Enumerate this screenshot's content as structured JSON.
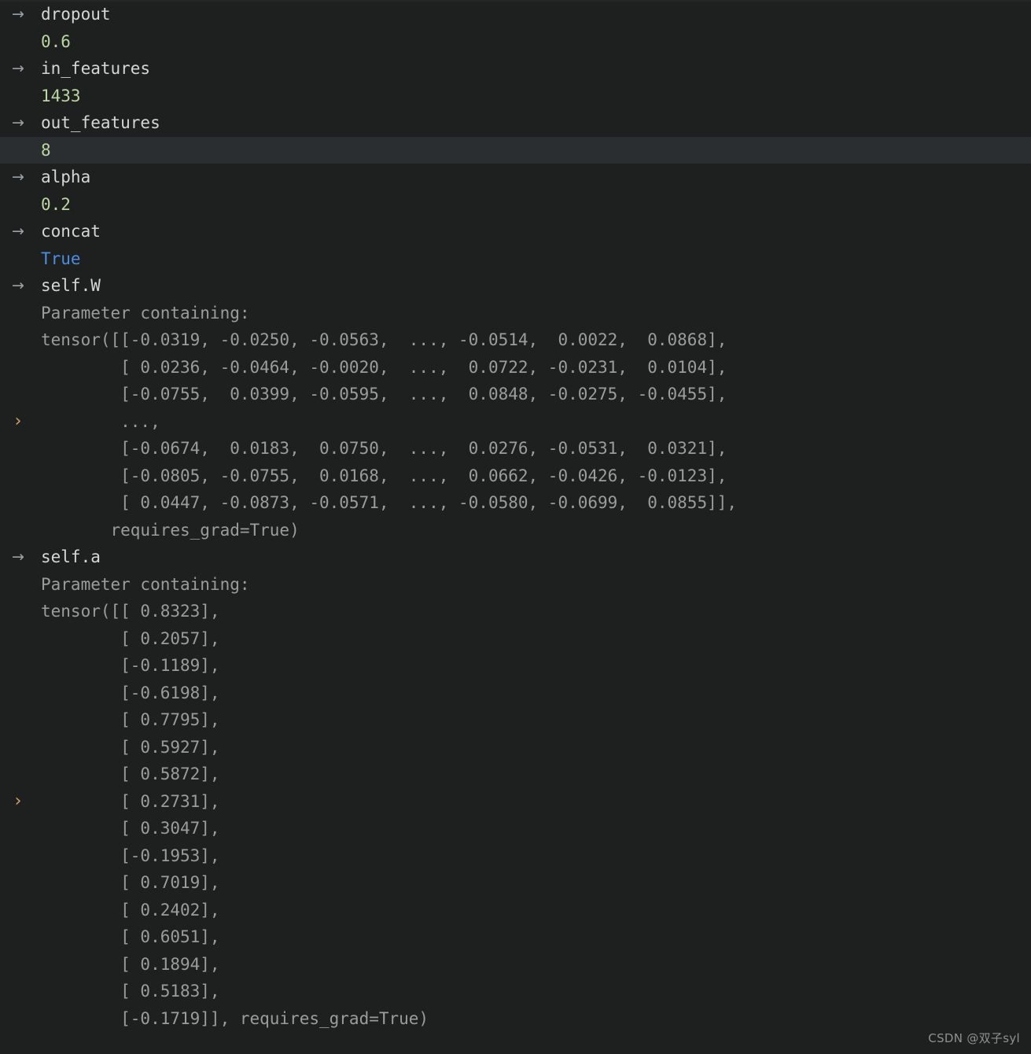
{
  "panel": {
    "title": "debugger-variables-pane",
    "background_color": "#1e1f1f",
    "highlight_color": "#2b2e30",
    "name_color": "#d4d7d6",
    "number_color": "#bcd6a0",
    "bool_color": "#4b8ee0",
    "dim_color": "#9b9c9b",
    "arrow_glyph": "→",
    "chevron_glyph": "›"
  },
  "lines": [
    {
      "gutter": "arrow",
      "kind": "name",
      "text": "dropout",
      "highlighted": false
    },
    {
      "gutter": "none",
      "kind": "number",
      "text": "0.6",
      "highlighted": false
    },
    {
      "gutter": "arrow",
      "kind": "name",
      "text": "in_features",
      "highlighted": false
    },
    {
      "gutter": "none",
      "kind": "number",
      "text": "1433",
      "highlighted": false
    },
    {
      "gutter": "arrow",
      "kind": "name",
      "text": "out_features",
      "highlighted": false
    },
    {
      "gutter": "none",
      "kind": "number",
      "text": "8",
      "highlighted": true
    },
    {
      "gutter": "arrow",
      "kind": "name",
      "text": "alpha",
      "highlighted": false
    },
    {
      "gutter": "none",
      "kind": "number",
      "text": "0.2",
      "highlighted": false
    },
    {
      "gutter": "arrow",
      "kind": "name",
      "text": "concat",
      "highlighted": false
    },
    {
      "gutter": "none",
      "kind": "bool",
      "text": "True",
      "highlighted": false
    },
    {
      "gutter": "arrow",
      "kind": "name",
      "text": "self.W",
      "highlighted": false
    },
    {
      "gutter": "none",
      "kind": "dim",
      "text": "Parameter containing:",
      "highlighted": false
    },
    {
      "gutter": "none",
      "kind": "dim",
      "text": "tensor([[-0.0319, -0.0250, -0.0563,  ..., -0.0514,  0.0022,  0.0868],",
      "highlighted": false
    },
    {
      "gutter": "none",
      "kind": "dim",
      "text": "        [ 0.0236, -0.0464, -0.0020,  ...,  0.0722, -0.0231,  0.0104],",
      "highlighted": false
    },
    {
      "gutter": "none",
      "kind": "dim",
      "text": "        [-0.0755,  0.0399, -0.0595,  ...,  0.0848, -0.0275, -0.0455],",
      "highlighted": false
    },
    {
      "gutter": "chevron",
      "kind": "dim",
      "text": "        ...,",
      "highlighted": false
    },
    {
      "gutter": "none",
      "kind": "dim",
      "text": "        [-0.0674,  0.0183,  0.0750,  ...,  0.0276, -0.0531,  0.0321],",
      "highlighted": false
    },
    {
      "gutter": "none",
      "kind": "dim",
      "text": "        [-0.0805, -0.0755,  0.0168,  ...,  0.0662, -0.0426, -0.0123],",
      "highlighted": false
    },
    {
      "gutter": "none",
      "kind": "dim",
      "text": "        [ 0.0447, -0.0873, -0.0571,  ..., -0.0580, -0.0699,  0.0855]],",
      "highlighted": false
    },
    {
      "gutter": "none",
      "kind": "dim",
      "text": "       requires_grad=True)",
      "highlighted": false
    },
    {
      "gutter": "arrow",
      "kind": "name",
      "text": "self.a",
      "highlighted": false
    },
    {
      "gutter": "none",
      "kind": "dim",
      "text": "Parameter containing:",
      "highlighted": false
    },
    {
      "gutter": "none",
      "kind": "dim",
      "text": "tensor([[ 0.8323],",
      "highlighted": false
    },
    {
      "gutter": "none",
      "kind": "dim",
      "text": "        [ 0.2057],",
      "highlighted": false
    },
    {
      "gutter": "none",
      "kind": "dim",
      "text": "        [-0.1189],",
      "highlighted": false
    },
    {
      "gutter": "none",
      "kind": "dim",
      "text": "        [-0.6198],",
      "highlighted": false
    },
    {
      "gutter": "none",
      "kind": "dim",
      "text": "        [ 0.7795],",
      "highlighted": false
    },
    {
      "gutter": "none",
      "kind": "dim",
      "text": "        [ 0.5927],",
      "highlighted": false
    },
    {
      "gutter": "none",
      "kind": "dim",
      "text": "        [ 0.5872],",
      "highlighted": false
    },
    {
      "gutter": "chevron",
      "kind": "dim",
      "text": "        [ 0.2731],",
      "highlighted": false
    },
    {
      "gutter": "none",
      "kind": "dim",
      "text": "        [ 0.3047],",
      "highlighted": false
    },
    {
      "gutter": "none",
      "kind": "dim",
      "text": "        [-0.1953],",
      "highlighted": false
    },
    {
      "gutter": "none",
      "kind": "dim",
      "text": "        [ 0.7019],",
      "highlighted": false
    },
    {
      "gutter": "none",
      "kind": "dim",
      "text": "        [ 0.2402],",
      "highlighted": false
    },
    {
      "gutter": "none",
      "kind": "dim",
      "text": "        [ 0.6051],",
      "highlighted": false
    },
    {
      "gutter": "none",
      "kind": "dim",
      "text": "        [ 0.1894],",
      "highlighted": false
    },
    {
      "gutter": "none",
      "kind": "dim",
      "text": "        [ 0.5183],",
      "highlighted": false
    },
    {
      "gutter": "none",
      "kind": "dim",
      "text": "        [-0.1719]], requires_grad=True)",
      "highlighted": false
    }
  ],
  "watermark": {
    "text": "CSDN @双子syl"
  }
}
